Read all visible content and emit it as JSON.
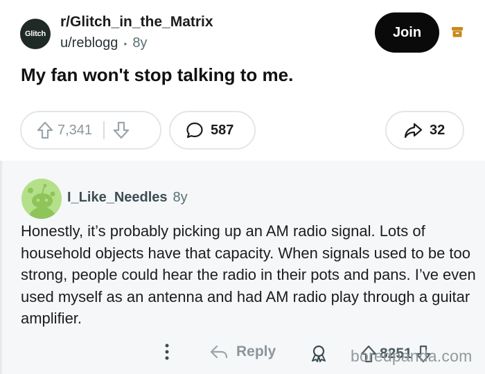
{
  "post": {
    "subreddit": "r/Glitch_in_the_Matrix",
    "subreddit_avatar_text": "Glitch",
    "author": "u/reblogg",
    "separator": "•",
    "age": "8y",
    "join_label": "Join",
    "title": "My fan won't stop talking to me.",
    "upvotes": "7,341",
    "comments": "587",
    "shares": "32",
    "icons": [
      "archive-icon",
      "upvote-icon",
      "downvote-icon",
      "comment-icon",
      "share-icon"
    ]
  },
  "comment": {
    "username": "I_Like_Needles",
    "age": "8y",
    "body": "Honestly, it’s probably picking up an AM radio signal. Lots of household objects have that capacity. When signals used to be too strong, people could hear the radio in their pots and pans. I’ve even used myself as an antenna and had AM radio play through a guitar amplifier.",
    "reply_label": "Reply",
    "votes": "8251",
    "icons": [
      "more-options-icon",
      "reply-arrow-icon",
      "award-icon",
      "upvote-icon",
      "downvote-icon"
    ]
  },
  "watermark": "boredpanda.com",
  "colors": {
    "join_background": "#0a0a0a",
    "archive_icon": "#c98a1a",
    "comment_background": "#f5f7f8",
    "avatar_green": "#b5e08a"
  }
}
